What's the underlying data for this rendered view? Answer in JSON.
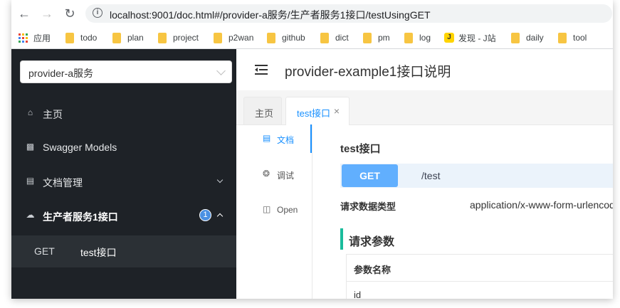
{
  "browser": {
    "url": "localhost:9001/doc.html#/provider-a服务/生产者服务1接口/testUsingGET",
    "bookmarks": [
      {
        "label": "应用",
        "icon": "apps-grid-icon"
      },
      {
        "label": "todo",
        "icon": "folder-icon"
      },
      {
        "label": "plan",
        "icon": "folder-icon"
      },
      {
        "label": "project",
        "icon": "folder-icon"
      },
      {
        "label": "p2wan",
        "icon": "folder-icon"
      },
      {
        "label": "github",
        "icon": "folder-icon"
      },
      {
        "label": "dict",
        "icon": "folder-icon"
      },
      {
        "label": "pm",
        "icon": "folder-icon"
      },
      {
        "label": "log",
        "icon": "folder-icon"
      },
      {
        "label": "发现 - J站",
        "icon": "jianshu-icon"
      },
      {
        "label": "daily",
        "icon": "folder-icon"
      },
      {
        "label": "tool",
        "icon": "folder-icon"
      }
    ]
  },
  "sidebar": {
    "service_select": "provider-a服务",
    "menu": [
      {
        "label": "主页",
        "icon": "home-icon"
      },
      {
        "label": "Swagger Models",
        "icon": "cube-icon"
      },
      {
        "label": "文档管理",
        "icon": "doc-settings-icon"
      },
      {
        "label": "生产者服务1接口",
        "icon": "cloud-icon",
        "badge": "1"
      }
    ],
    "sub_item": {
      "method": "GET",
      "name": "test接口"
    }
  },
  "header": {
    "title": "provider-example1接口说明"
  },
  "tabs": [
    {
      "label": "主页"
    },
    {
      "label": "test接口"
    }
  ],
  "side_tabs": [
    {
      "label": "文档",
      "icon": "document-icon"
    },
    {
      "label": "调试",
      "icon": "bug-icon"
    },
    {
      "label": "Open",
      "icon": "file-icon"
    }
  ],
  "operation": {
    "title": "test接口",
    "method": "GET",
    "path": "/test",
    "request_type_label": "请求数据类型",
    "request_type_value": "application/x-www-form-urlencoded",
    "params_title": "请求参数",
    "params_header": "参数名称",
    "params": [
      "id"
    ]
  },
  "colors": {
    "sidebar_bg": "#1e2227",
    "accent": "#1890ff",
    "get_method": "#61affe",
    "section_marker": "#1abc9c"
  }
}
